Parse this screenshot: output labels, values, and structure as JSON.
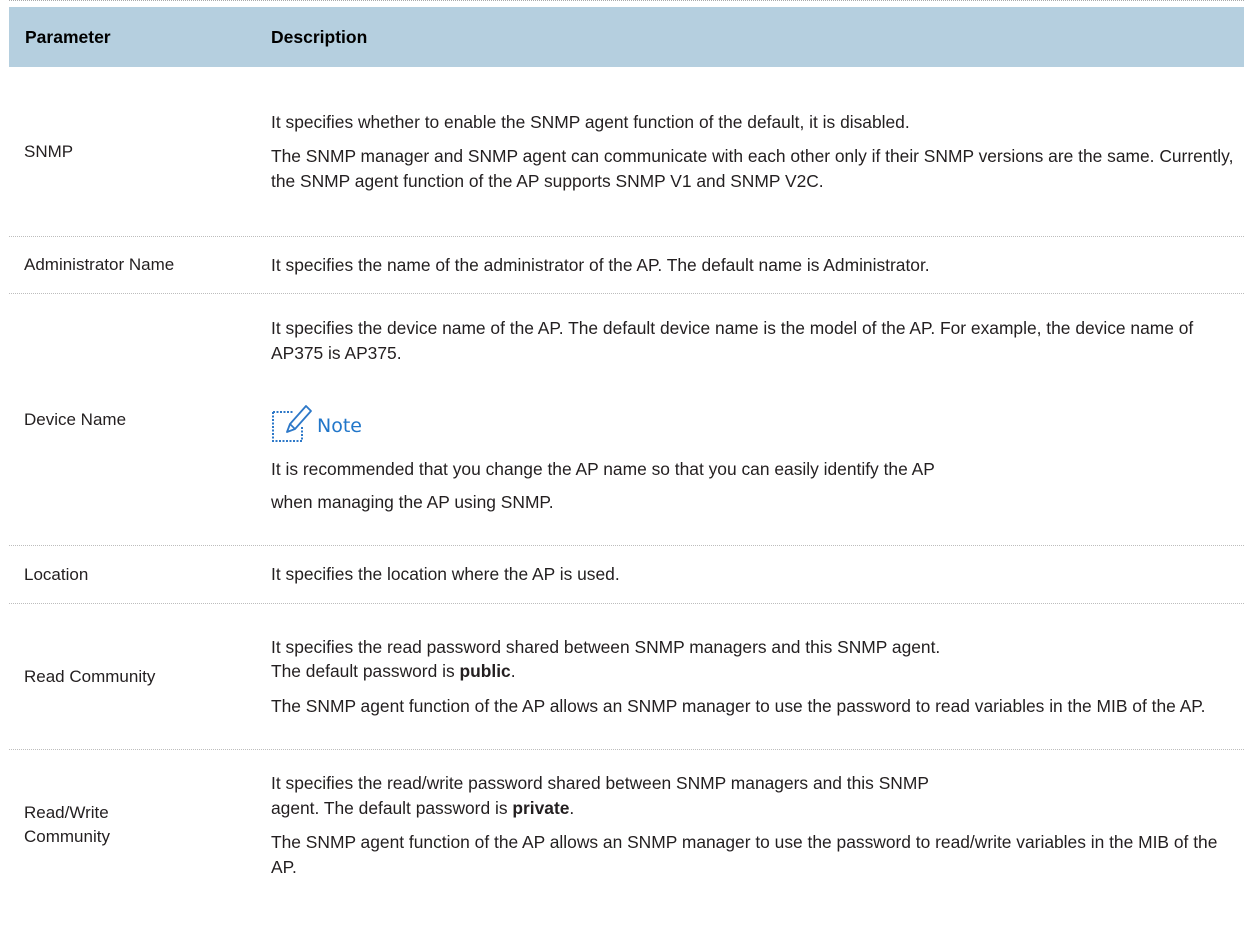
{
  "table": {
    "headers": {
      "parameter": "Parameter",
      "description": "Description"
    },
    "rows": [
      {
        "name": "SNMP",
        "desc": [
          "It specifies whether to enable the SNMP agent function of the default, it is disabled.",
          "The SNMP manager and SNMP agent can communicate with each other only if their SNMP versions are the same. Currently, the SNMP agent function of the AP supports SNMP V1 and SNMP V2C."
        ]
      },
      {
        "name": "Administrator Name",
        "desc": [
          "It specifies the name of the administrator of the AP. The default name is Administrator."
        ]
      },
      {
        "name": "Device Name",
        "desc": [
          "It specifies the device name of the AP. The default device name is the model of the AP. For example, the device name of AP375 is AP375."
        ],
        "note": {
          "icon": "pencil-note-icon",
          "title": "Note",
          "text1": "It is recommended that you change the AP name so that you can easily identify the AP",
          "text2": "when managing the AP using SNMP."
        }
      },
      {
        "name": "Location",
        "desc": [
          "It specifies the location where the AP is used."
        ]
      },
      {
        "name": "Read Community",
        "desc1_pre": "It specifies the read password shared between SNMP managers and this SNMP agent.",
        "desc1_line2_pre": "The default password is ",
        "desc1_bold": "public",
        "desc1_post": ".",
        "desc2": "The SNMP agent function of the AP allows an SNMP manager to use the password to read variables in the MIB of the AP."
      },
      {
        "name_line1": "Read/Write",
        "name_line2": "Community",
        "desc1_pre": "It specifies the read/write password shared between SNMP managers and this SNMP",
        "desc1_line2_pre": "agent. The default password is ",
        "desc1_bold": "private",
        "desc1_post": ".",
        "desc2": "The SNMP agent function of the AP allows an SNMP manager to use the password to read/write variables in the MIB of the AP."
      }
    ]
  }
}
